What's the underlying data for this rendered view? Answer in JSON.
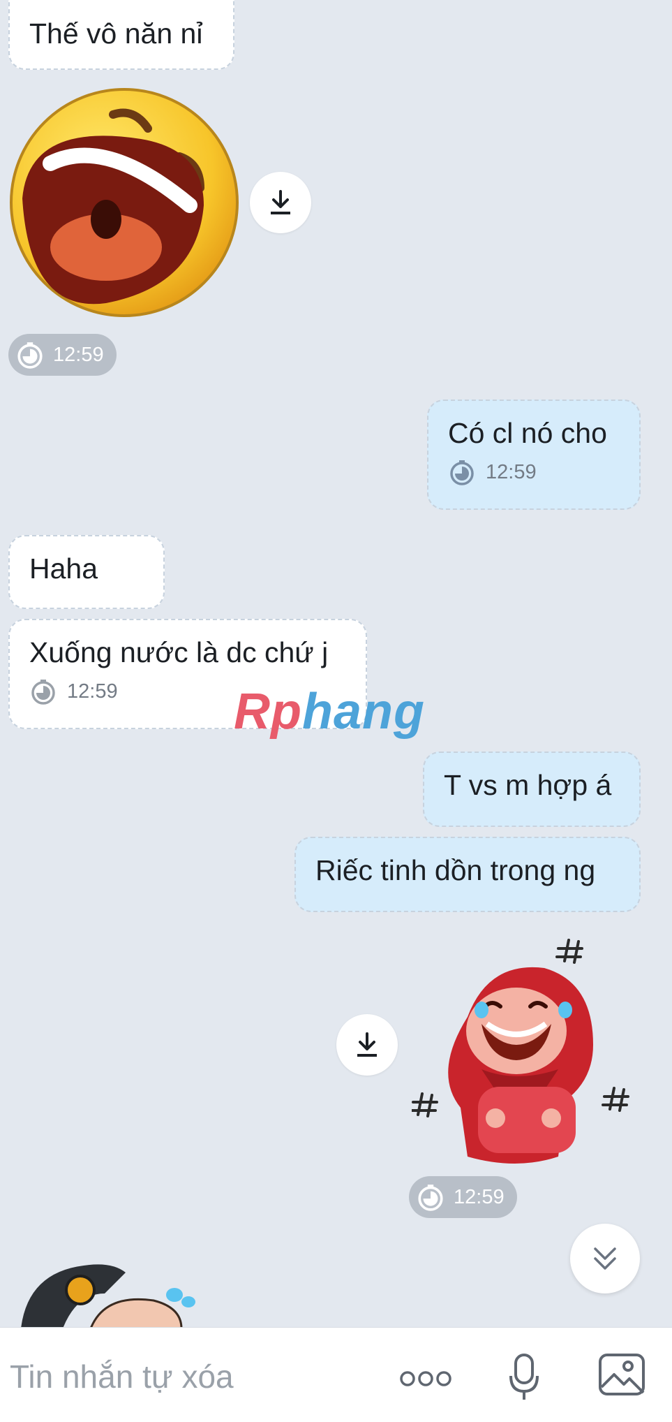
{
  "messages": {
    "m1": {
      "text": "Thế vô năn nỉ"
    },
    "sticker1_time": "12:59",
    "m2": {
      "text": "Có cl nó cho",
      "time": "12:59"
    },
    "m3": {
      "text": "Haha"
    },
    "m4": {
      "text": "Xuống nước là dc chứ j",
      "time": "12:59"
    },
    "m5": {
      "text": "T vs m hợp á"
    },
    "m6": {
      "text": "Riếc tinh dồn trong ng"
    },
    "sticker2_time": "12:59"
  },
  "watermark": {
    "part1": "Rp",
    "part2": "hang"
  },
  "composer": {
    "placeholder": "Tin nhắn tự xóa"
  },
  "icons": {
    "download": "download-icon",
    "timer": "timer-icon",
    "scroll_down": "double-chevron-down-icon",
    "more": "more-dots-icon",
    "mic": "microphone-icon",
    "image": "image-icon"
  },
  "colors": {
    "background": "#e3e8ef",
    "received_bubble": "#ffffff",
    "sent_bubble": "#d6ecfb",
    "time_pill": "#b8bfc8"
  }
}
